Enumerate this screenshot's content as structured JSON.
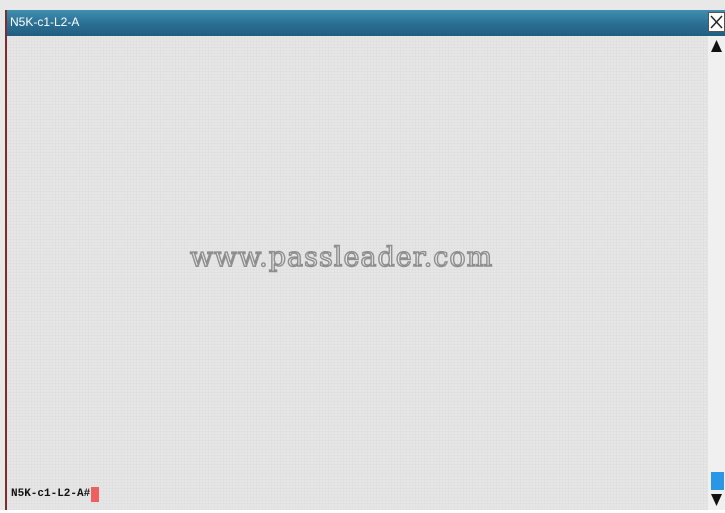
{
  "window": {
    "title": "N5K-c1-L2-A"
  },
  "terminal": {
    "watermark": "www.passleader.com",
    "prompt": "N5K-c1-L2-A#"
  },
  "icons": {
    "close": "close-icon",
    "scroll_up": "arrow-up-icon",
    "scroll_down": "arrow-down-icon"
  },
  "colors": {
    "titlebar": "#2a6e93",
    "title_text": "#ffffff",
    "terminal_bg": "#e6e6e6",
    "cursor": "#ef5f5f",
    "scroll_thumb": "#2996e6"
  }
}
